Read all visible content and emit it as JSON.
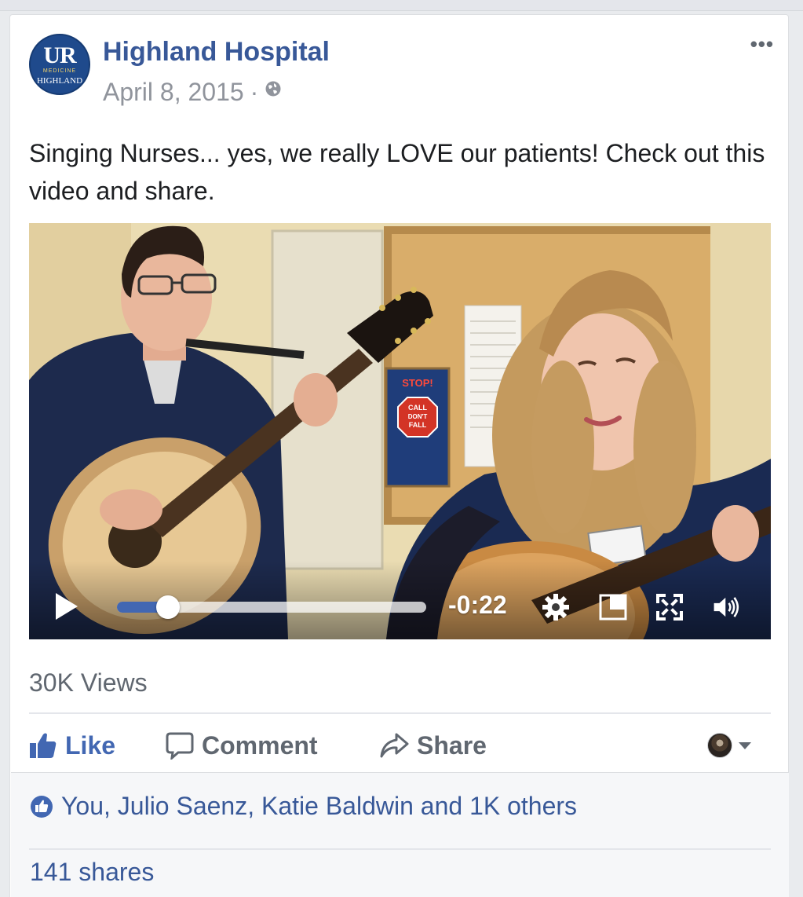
{
  "post": {
    "page_name": "Highland Hospital",
    "date": "April 8, 2015",
    "separator": "·",
    "more_label": "•••",
    "text": "Singing Nurses... yes, we really LOVE our patients! Check out this video and share.",
    "avatar": {
      "logo_top": "UR",
      "logo_sub": "MEDICINE",
      "logo_bottom": "HIGHLAND"
    }
  },
  "video": {
    "time_remaining": "-0:22",
    "progress": 0.14,
    "poster_sign": {
      "heading": "STOP!",
      "line1": "CALL",
      "line2": "DON'T",
      "line3": "FALL"
    }
  },
  "stats": {
    "views": "30K Views"
  },
  "actions": {
    "like": "Like",
    "comment": "Comment",
    "share": "Share"
  },
  "footer": {
    "likers": "You, Julio Saenz, Katie Baldwin and 1K others",
    "shares": "141 shares"
  },
  "colors": {
    "link_blue": "#385898",
    "brand_blue": "#4267b2",
    "meta_gray": "#90949c"
  }
}
